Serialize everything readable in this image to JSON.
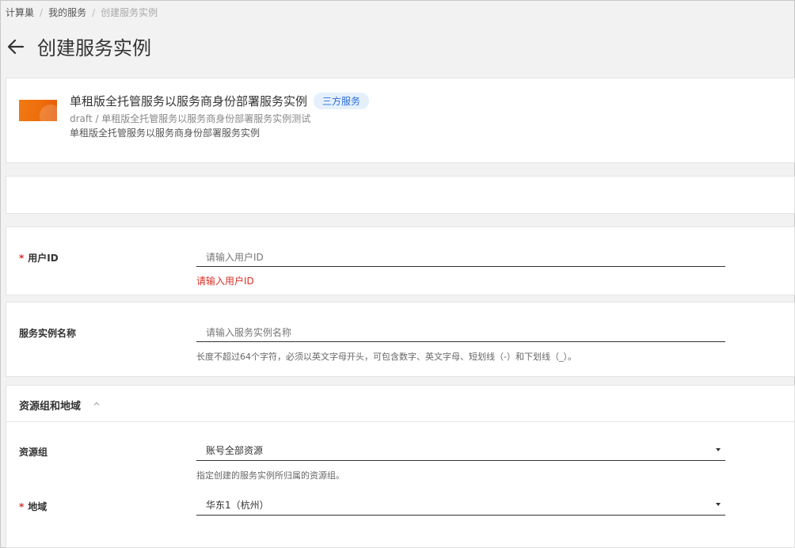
{
  "breadcrumb": {
    "items": [
      "计算巢",
      "我的服务"
    ],
    "current": "创建服务实例",
    "separator": "/"
  },
  "page": {
    "title": "创建服务实例",
    "back_icon": "arrow-left-icon"
  },
  "service": {
    "name": "单租版全托管服务以服务商身份部署服务实例",
    "tag": "三方服务",
    "path": "draft / 单租版全托管服务以服务商身份部署服务实例测试",
    "description": "单租版全托管服务以服务商身份部署服务实例",
    "logo_color": "#f07a12"
  },
  "form": {
    "user_id": {
      "required_mark": "*",
      "label": "用户ID",
      "placeholder": "请输入用户ID",
      "value": "",
      "error": "请输入用户ID"
    },
    "instance_name": {
      "label": "服务实例名称",
      "placeholder": "请输入服务实例名称",
      "value": "",
      "help": "长度不超过64个字符，必须以英文字母开头，可包含数字、英文字母、短划线（-）和下划线（_）。"
    },
    "resource_region_section": {
      "title": "资源组和地域",
      "toggle_icon": "chevron-up-icon",
      "resource_group": {
        "label": "资源组",
        "value": "账号全部资源",
        "help": "指定创建的服务实例所归属的资源组。"
      },
      "region": {
        "required_mark": "*",
        "label": "地域",
        "value": "华东1（杭州）"
      }
    }
  },
  "colors": {
    "error": "#d93026",
    "tag_bg": "#e5f0fc",
    "tag_text": "#2b6fd6"
  }
}
